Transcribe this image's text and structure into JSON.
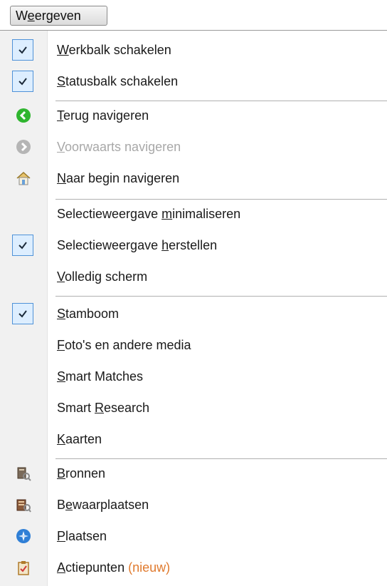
{
  "menu": {
    "title_pre": "W",
    "title_ul": "e",
    "title_post": "ergeven"
  },
  "items": [
    {
      "pre": "",
      "ul": "W",
      "post": "erkbalk schakelen",
      "icon": "checkmark-icon",
      "checked": true
    },
    {
      "pre": "",
      "ul": "S",
      "post": "tatusbalk schakelen",
      "icon": "checkmark-icon",
      "checked": true
    },
    {
      "pre": "",
      "ul": "T",
      "post": "erug navigeren",
      "icon": "back-arrow-icon",
      "color": "#2fb52f"
    },
    {
      "pre": "",
      "ul": "V",
      "post": "oorwaarts navigeren",
      "icon": "forward-arrow-icon",
      "disabled": true,
      "color": "#b5b5b5"
    },
    {
      "pre": "",
      "ul": "N",
      "post": "aar begin navigeren",
      "icon": "home-icon"
    },
    {
      "pre": "Selectieweergave ",
      "ul": "m",
      "post": "inimaliseren"
    },
    {
      "pre": "Selectieweergave ",
      "ul": "h",
      "post": "erstellen",
      "icon": "checkmark-icon",
      "checked": true
    },
    {
      "pre": "",
      "ul": "V",
      "post": "olledig scherm"
    },
    {
      "pre": "",
      "ul": "S",
      "post": "tamboom",
      "icon": "checkmark-icon",
      "checked": true
    },
    {
      "pre": "",
      "ul": "F",
      "post": "oto's en andere media"
    },
    {
      "pre": "",
      "ul": "S",
      "post": "mart Matches"
    },
    {
      "pre": "Smart ",
      "ul": "R",
      "post": "esearch"
    },
    {
      "pre": "",
      "ul": "K",
      "post": "aarten"
    },
    {
      "pre": "",
      "ul": "B",
      "post": "ronnen",
      "icon": "sources-icon"
    },
    {
      "pre": "B",
      "ul": "e",
      "post": "waarplaatsen",
      "icon": "repositories-icon"
    },
    {
      "pre": "",
      "ul": "P",
      "post": "laatsen",
      "icon": "places-compass-icon",
      "color": "#2f7fd6"
    },
    {
      "pre": "",
      "ul": "A",
      "post": "ctiepunten",
      "suffix": "(nieuw)",
      "icon": "task-clipboard-icon",
      "accent": "#e07a2e"
    }
  ]
}
